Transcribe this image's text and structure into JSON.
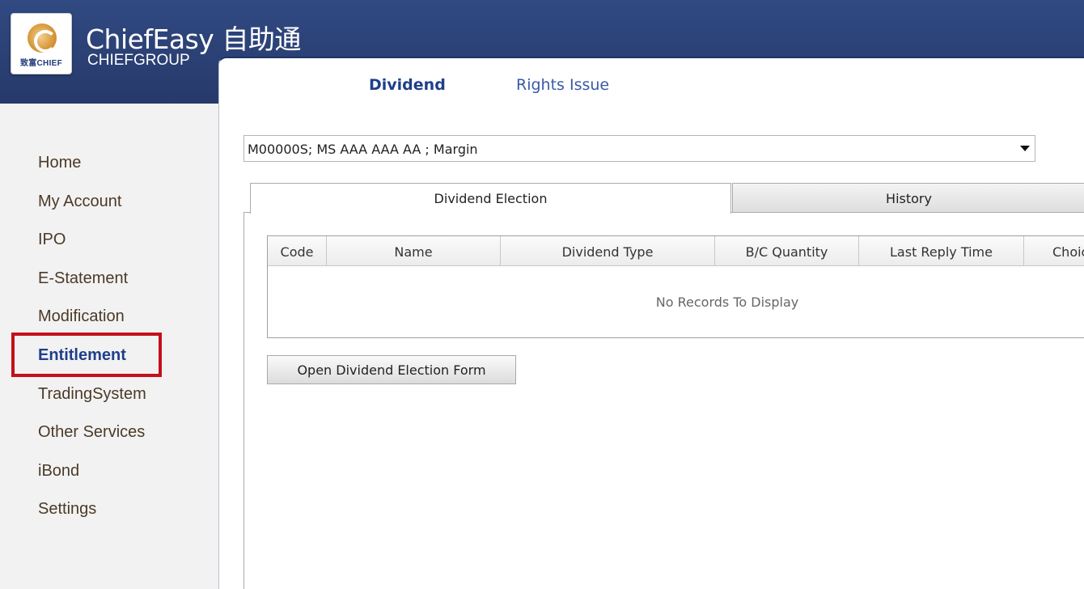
{
  "header": {
    "logo_text": "致富CHIEF",
    "app_name": "ChiefEasy 自助通",
    "app_sub": "CHIEFGROUP"
  },
  "sidebar": {
    "items": [
      {
        "label": "Home"
      },
      {
        "label": "My Account"
      },
      {
        "label": "IPO"
      },
      {
        "label": "E-Statement"
      },
      {
        "label": "Modification"
      },
      {
        "label": "Entitlement",
        "active": true
      },
      {
        "label": "TradingSystem"
      },
      {
        "label": "Other Services"
      },
      {
        "label": "iBond"
      },
      {
        "label": "Settings"
      }
    ]
  },
  "top_tabs": [
    {
      "label": "Dividend",
      "active": true
    },
    {
      "label": "Rights Issue"
    }
  ],
  "account_select": {
    "value": "M00000S; MS AAA AAA AA ; Margin"
  },
  "inner_tabs": [
    {
      "label": "Dividend Election",
      "active": true
    },
    {
      "label": "History"
    }
  ],
  "grid": {
    "columns": [
      "Code",
      "Name",
      "Dividend Type",
      "B/C Quantity",
      "Last Reply Time",
      "Choic"
    ],
    "rows": [],
    "empty_text": "No Records To Display"
  },
  "actions": {
    "open_form_label": "Open Dividend Election Form"
  },
  "colors": {
    "header_bg": "#2c4277",
    "active_nav": "#1e3f8a",
    "highlight_border": "#c4101a"
  }
}
